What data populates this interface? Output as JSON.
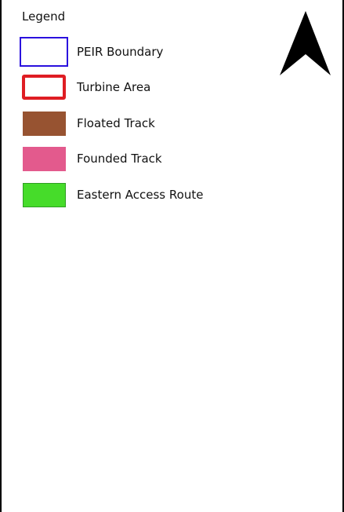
{
  "legend": {
    "title": "Legend",
    "items": [
      {
        "label": "PEIR Boundary",
        "style": "outline",
        "color": "#2a10de"
      },
      {
        "label": "Turbine Area",
        "style": "outline-thick",
        "color": "#df1d23"
      },
      {
        "label": "Floated Track",
        "style": "fill",
        "color": "#975331"
      },
      {
        "label": "Founded Track",
        "style": "fill",
        "color": "#e35a8d"
      },
      {
        "label": "Eastern Access Route",
        "style": "fill",
        "color": "#46dc2a",
        "border": "#2e9e22"
      }
    ]
  },
  "north_arrow": {
    "icon": "north-arrow-icon",
    "color": "#000000"
  }
}
